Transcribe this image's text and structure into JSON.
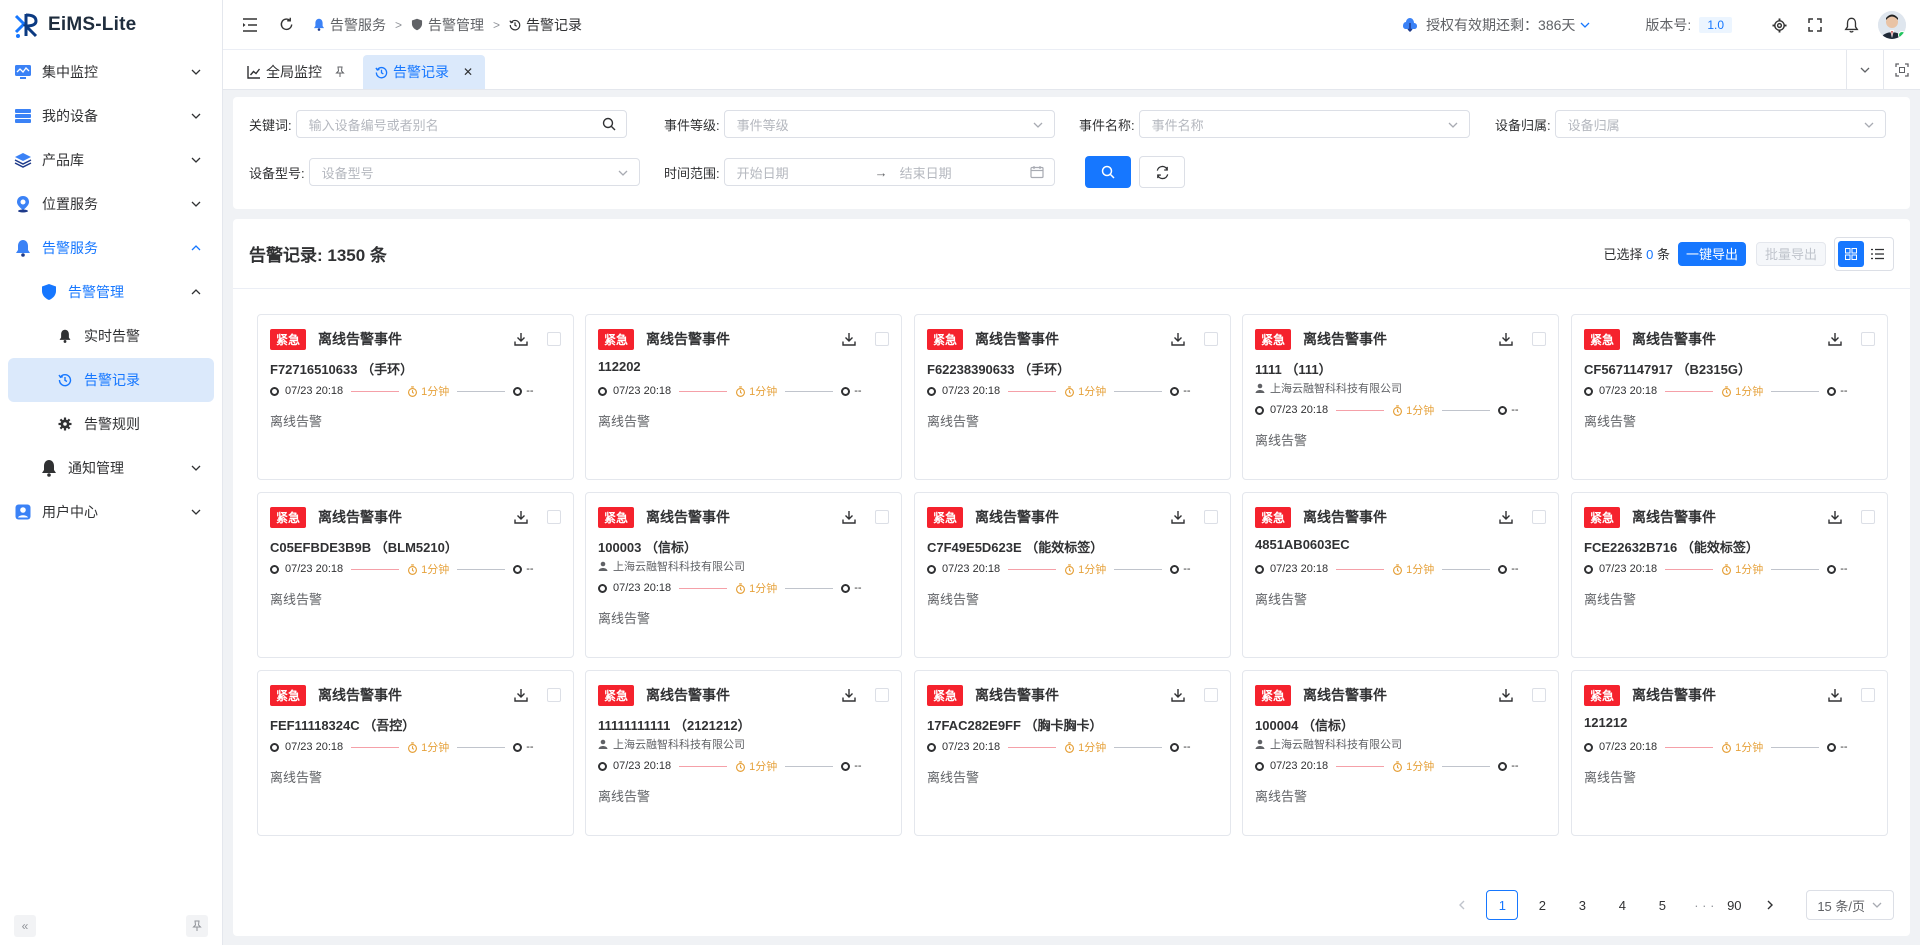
{
  "app": {
    "name": "EiMS-Lite"
  },
  "sidebar": {
    "items": [
      {
        "label": "集中监控",
        "icon": "monitor-icon"
      },
      {
        "label": "我的设备",
        "icon": "device-list-icon"
      },
      {
        "label": "产品库",
        "icon": "layers-icon"
      },
      {
        "label": "位置服务",
        "icon": "location-icon"
      },
      {
        "label": "告警服务",
        "icon": "bell-icon"
      },
      {
        "label": "告警管理",
        "icon": "shield-icon"
      },
      {
        "label": "实时告警",
        "icon": "bell-icon"
      },
      {
        "label": "告警记录",
        "icon": "history-icon"
      },
      {
        "label": "告警规则",
        "icon": "gear-icon"
      },
      {
        "label": "通知管理",
        "icon": "bell-icon"
      },
      {
        "label": "用户中心",
        "icon": "user-icon"
      }
    ]
  },
  "header": {
    "breadcrumb": [
      "告警服务",
      "告警管理",
      "告警记录"
    ],
    "license": "授权有效期还剩：386天",
    "version_label": "版本号:",
    "version": "1.0"
  },
  "tabs": [
    {
      "label": "全局监控"
    },
    {
      "label": "告警记录"
    }
  ],
  "filter": {
    "keyword_label": "关键词:",
    "keyword_placeholder": "输入设备编号或者别名",
    "level_label": "事件等级:",
    "level_placeholder": "事件等级",
    "name_label": "事件名称:",
    "name_placeholder": "事件名称",
    "owner_label": "设备归属:",
    "owner_placeholder": "设备归属",
    "model_label": "设备型号:",
    "model_placeholder": "设备型号",
    "time_label": "时间范围:",
    "start_placeholder": "开始日期",
    "end_placeholder": "结束日期"
  },
  "result": {
    "title": "告警记录: 1350 条",
    "selected_prefix": "已选择",
    "selected_count": "0",
    "selected_suffix": "条",
    "export_all": "一键导出",
    "export_batch": "批量导出"
  },
  "cards": [
    {
      "tag": "紧急",
      "event": "离线告警事件",
      "device": "F72716510633 （手环）",
      "org": "",
      "time": "07/23 20:18",
      "duration": "1分钟",
      "end": "--",
      "type": "离线告警"
    },
    {
      "tag": "紧急",
      "event": "离线告警事件",
      "device": "112202",
      "org": "",
      "time": "07/23 20:18",
      "duration": "1分钟",
      "end": "--",
      "type": "离线告警"
    },
    {
      "tag": "紧急",
      "event": "离线告警事件",
      "device": "F62238390633 （手环）",
      "org": "",
      "time": "07/23 20:18",
      "duration": "1分钟",
      "end": "--",
      "type": "离线告警"
    },
    {
      "tag": "紧急",
      "event": "离线告警事件",
      "device": "1111 （111）",
      "org": "上海云融智科科技有限公司",
      "time": "07/23 20:18",
      "duration": "1分钟",
      "end": "--",
      "type": "离线告警"
    },
    {
      "tag": "紧急",
      "event": "离线告警事件",
      "device": "CF5671147917 （B2315G）",
      "org": "",
      "time": "07/23 20:18",
      "duration": "1分钟",
      "end": "--",
      "type": "离线告警"
    },
    {
      "tag": "紧急",
      "event": "离线告警事件",
      "device": "C05EFBDE3B9B （BLM5210）",
      "org": "",
      "time": "07/23 20:18",
      "duration": "1分钟",
      "end": "--",
      "type": "离线告警"
    },
    {
      "tag": "紧急",
      "event": "离线告警事件",
      "device": "100003 （信标）",
      "org": "上海云融智科科技有限公司",
      "time": "07/23 20:18",
      "duration": "1分钟",
      "end": "--",
      "type": "离线告警"
    },
    {
      "tag": "紧急",
      "event": "离线告警事件",
      "device": "C7F49E5D623E （能效标签）",
      "org": "",
      "time": "07/23 20:18",
      "duration": "1分钟",
      "end": "--",
      "type": "离线告警"
    },
    {
      "tag": "紧急",
      "event": "离线告警事件",
      "device": "4851AB0603EC",
      "org": "",
      "time": "07/23 20:18",
      "duration": "1分钟",
      "end": "--",
      "type": "离线告警"
    },
    {
      "tag": "紧急",
      "event": "离线告警事件",
      "device": "FCE22632B716 （能效标签）",
      "org": "",
      "time": "07/23 20:18",
      "duration": "1分钟",
      "end": "--",
      "type": "离线告警"
    },
    {
      "tag": "紧急",
      "event": "离线告警事件",
      "device": "FEF11118324C （吾控）",
      "org": "",
      "time": "07/23 20:18",
      "duration": "1分钟",
      "end": "--",
      "type": "离线告警"
    },
    {
      "tag": "紧急",
      "event": "离线告警事件",
      "device": "11111111111 （2121212）",
      "org": "上海云融智科科技有限公司",
      "time": "07/23 20:18",
      "duration": "1分钟",
      "end": "--",
      "type": "离线告警"
    },
    {
      "tag": "紧急",
      "event": "离线告警事件",
      "device": "17FAC282E9FF （胸卡胸卡）",
      "org": "",
      "time": "07/23 20:18",
      "duration": "1分钟",
      "end": "--",
      "type": "离线告警"
    },
    {
      "tag": "紧急",
      "event": "离线告警事件",
      "device": "100004 （信标）",
      "org": "上海云融智科科技有限公司",
      "time": "07/23 20:18",
      "duration": "1分钟",
      "end": "--",
      "type": "离线告警"
    },
    {
      "tag": "紧急",
      "event": "离线告警事件",
      "device": "121212",
      "org": "",
      "time": "07/23 20:18",
      "duration": "1分钟",
      "end": "--",
      "type": "离线告警"
    }
  ],
  "pagination": {
    "pages": [
      "1",
      "2",
      "3",
      "4",
      "5"
    ],
    "ellipsis": "· · ·",
    "last": "90",
    "current": "1",
    "page_size": "15 条/页"
  }
}
